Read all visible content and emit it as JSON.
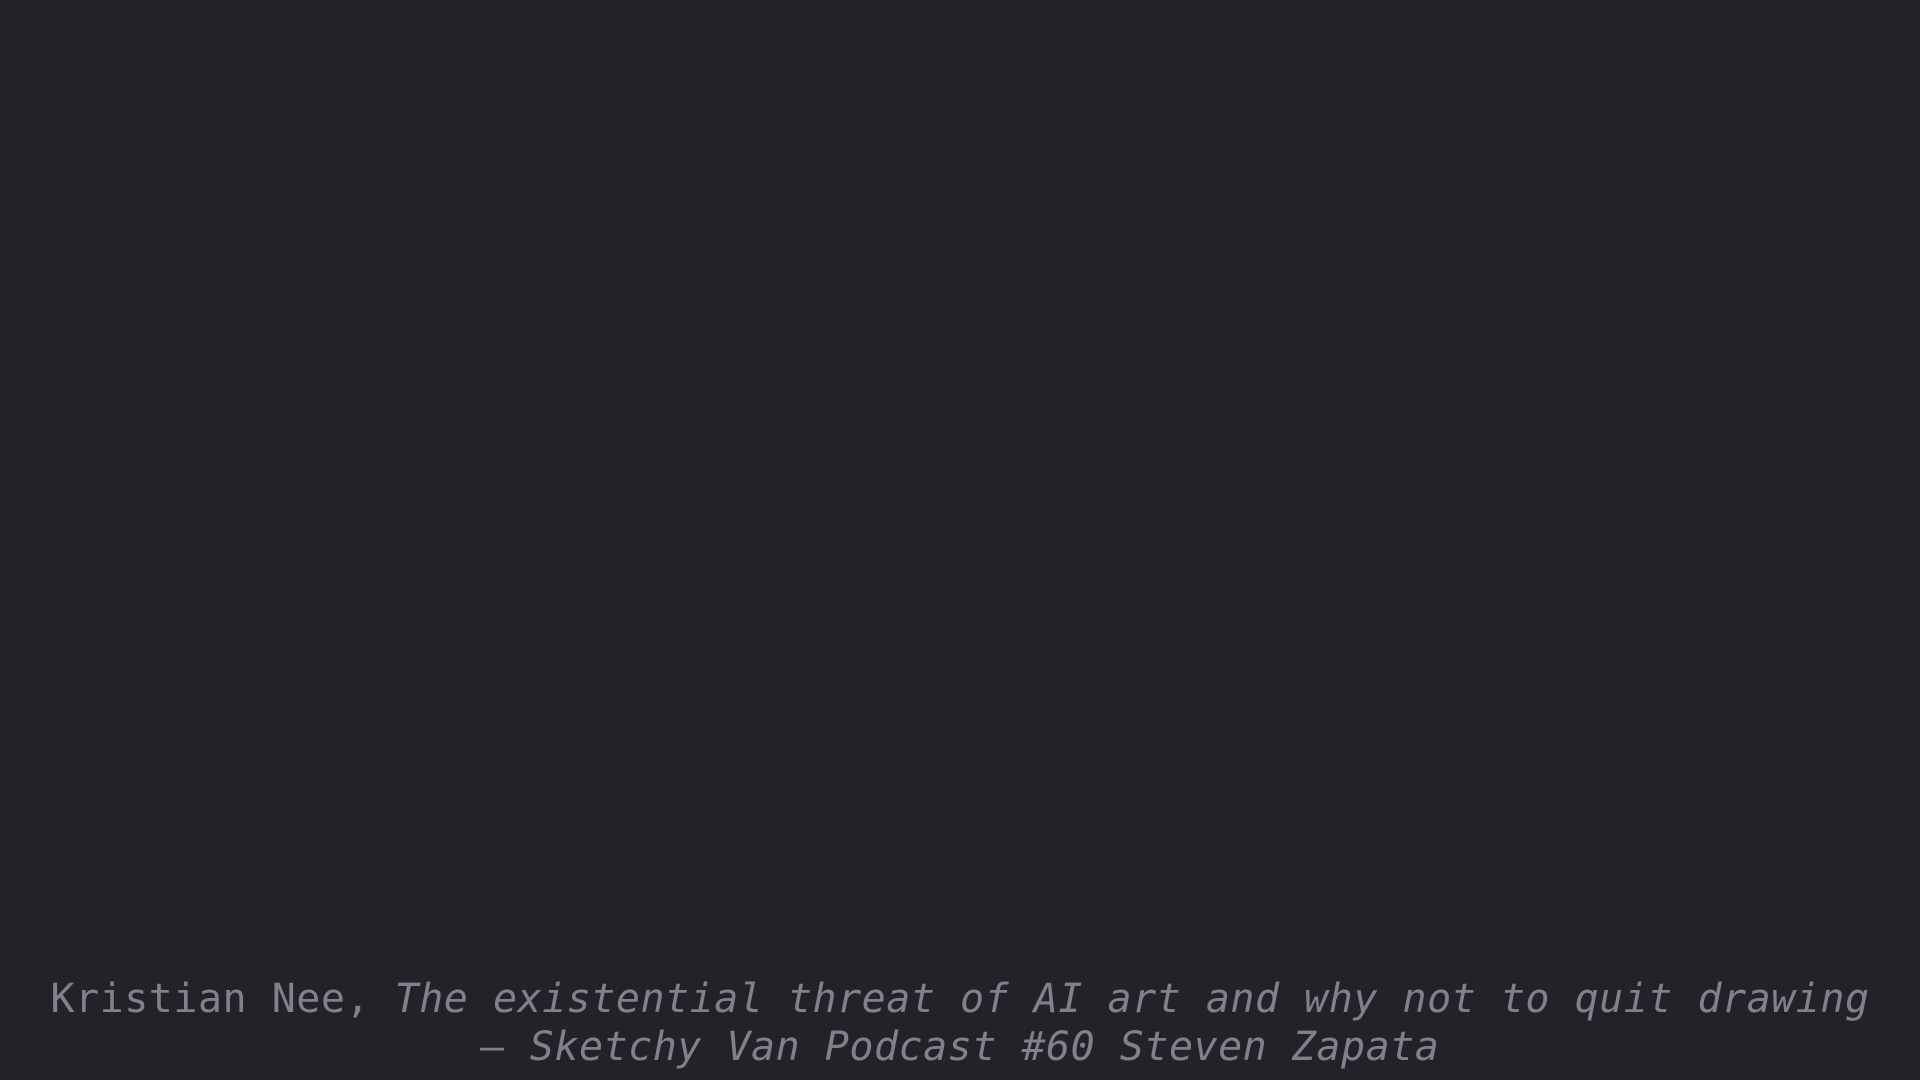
{
  "background_color": "#222329",
  "text_color": "#80818c",
  "caption": {
    "author": "Kristian Nee,",
    "title_part1": "The existential threat of AI art and why not to quit drawing",
    "title_part2": "– Sketchy Van Podcast #60 Steven Zapata"
  }
}
